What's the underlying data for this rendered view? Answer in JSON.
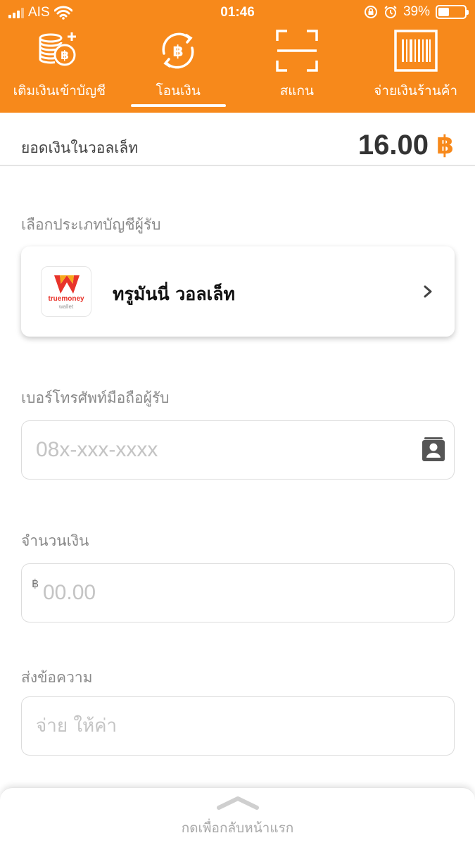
{
  "status_bar": {
    "carrier": "AIS",
    "time": "01:46",
    "battery_percent": "39%",
    "battery_level": 0.39,
    "icons": [
      "signal-icon",
      "wifi-icon",
      "rotation-lock-icon",
      "alarm-icon",
      "battery-icon"
    ]
  },
  "nav": {
    "items": [
      {
        "label": "เติมเงินเข้าบัญชี",
        "icon": "coins-plus-icon"
      },
      {
        "label": "โอนเงิน",
        "icon": "baht-transfer-icon",
        "active": true
      },
      {
        "label": "สแกน",
        "icon": "scan-icon"
      },
      {
        "label": "จ่ายเงินร้านค้า",
        "icon": "barcode-icon"
      }
    ]
  },
  "balance": {
    "label": "ยอดเงินในวอลเล็ท",
    "value": "16.00",
    "currency": "฿"
  },
  "recipient_type": {
    "label": "เลือกประเภทบัญชีผู้รับ",
    "selected": "ทรูมันนี่ วอลเล็ท",
    "logo_text": "truemoney",
    "logo_subtext": "wallet"
  },
  "phone": {
    "label": "เบอร์โทรศัพท์มือถือผู้รับ",
    "placeholder": "08x-xxx-xxxx",
    "value": ""
  },
  "amount": {
    "label": "จำนวนเงิน",
    "currency_prefix": "฿",
    "placeholder": "00.00",
    "value": ""
  },
  "message": {
    "label": "ส่งข้อความ",
    "placeholder": "จ่าย ให้ค่า",
    "value": ""
  },
  "bottom_sheet": {
    "label": "กดเพื่อกลับหน้าแรก"
  },
  "colors": {
    "accent": "#f7891b",
    "brand_red": "#e8332a"
  }
}
